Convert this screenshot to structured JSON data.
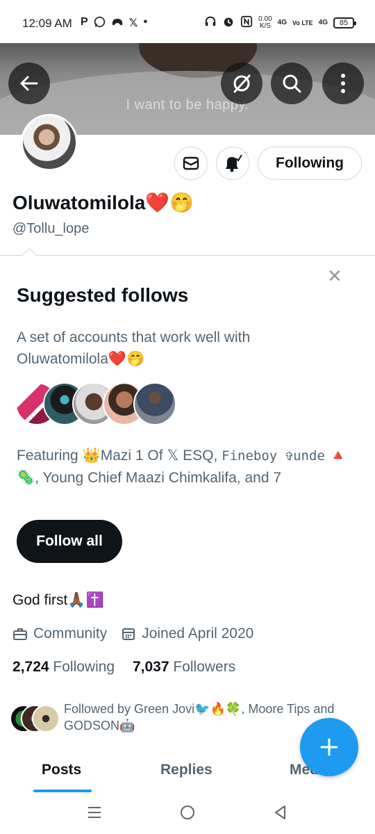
{
  "status_bar": {
    "time": "12:09 AM",
    "left_icons": [
      "P",
      "whatsapp-icon",
      "game-icon",
      "𝕏",
      "•"
    ],
    "speed": "0.00",
    "speed_unit": "K/S",
    "net1": "4G",
    "net2": "Vo LTE",
    "net3": "4G",
    "battery": "85"
  },
  "banner": {
    "text": "I want to be happy."
  },
  "profile": {
    "display_name": "Oluwatomilola❤️🤭",
    "handle": "@Tollu_lope",
    "following_button": "Following",
    "bio": "God first🙏🏾✝️",
    "category": "Community",
    "joined": "Joined April 2020",
    "following_count": "2,724",
    "following_label": "Following",
    "followers_count": "7,037",
    "followers_label": "Followers",
    "followed_by": "Followed by Green Jovi🐦🔥🍀, Moore Tips and GODSON🤖"
  },
  "suggested": {
    "title": "Suggested follows",
    "description": "A set of accounts that work well with Oluwatomilola❤️🤭",
    "featuring_prefix": "Featuring 👑Mazi 1 Of 𝕏 ESQ, ",
    "featuring_mono": "Fineboy ✞unde",
    "featuring_rest": " 🔺🦠, Young Chief Maazi Chimkalifa, and 7",
    "follow_all": "Follow all"
  },
  "tabs": [
    {
      "label": "Posts"
    },
    {
      "label": "Replies"
    },
    {
      "label": "Media"
    }
  ],
  "colors": {
    "accent": "#1d9bf0",
    "text": "#0f1419",
    "secondary": "#536471",
    "border": "#cfd9de"
  }
}
